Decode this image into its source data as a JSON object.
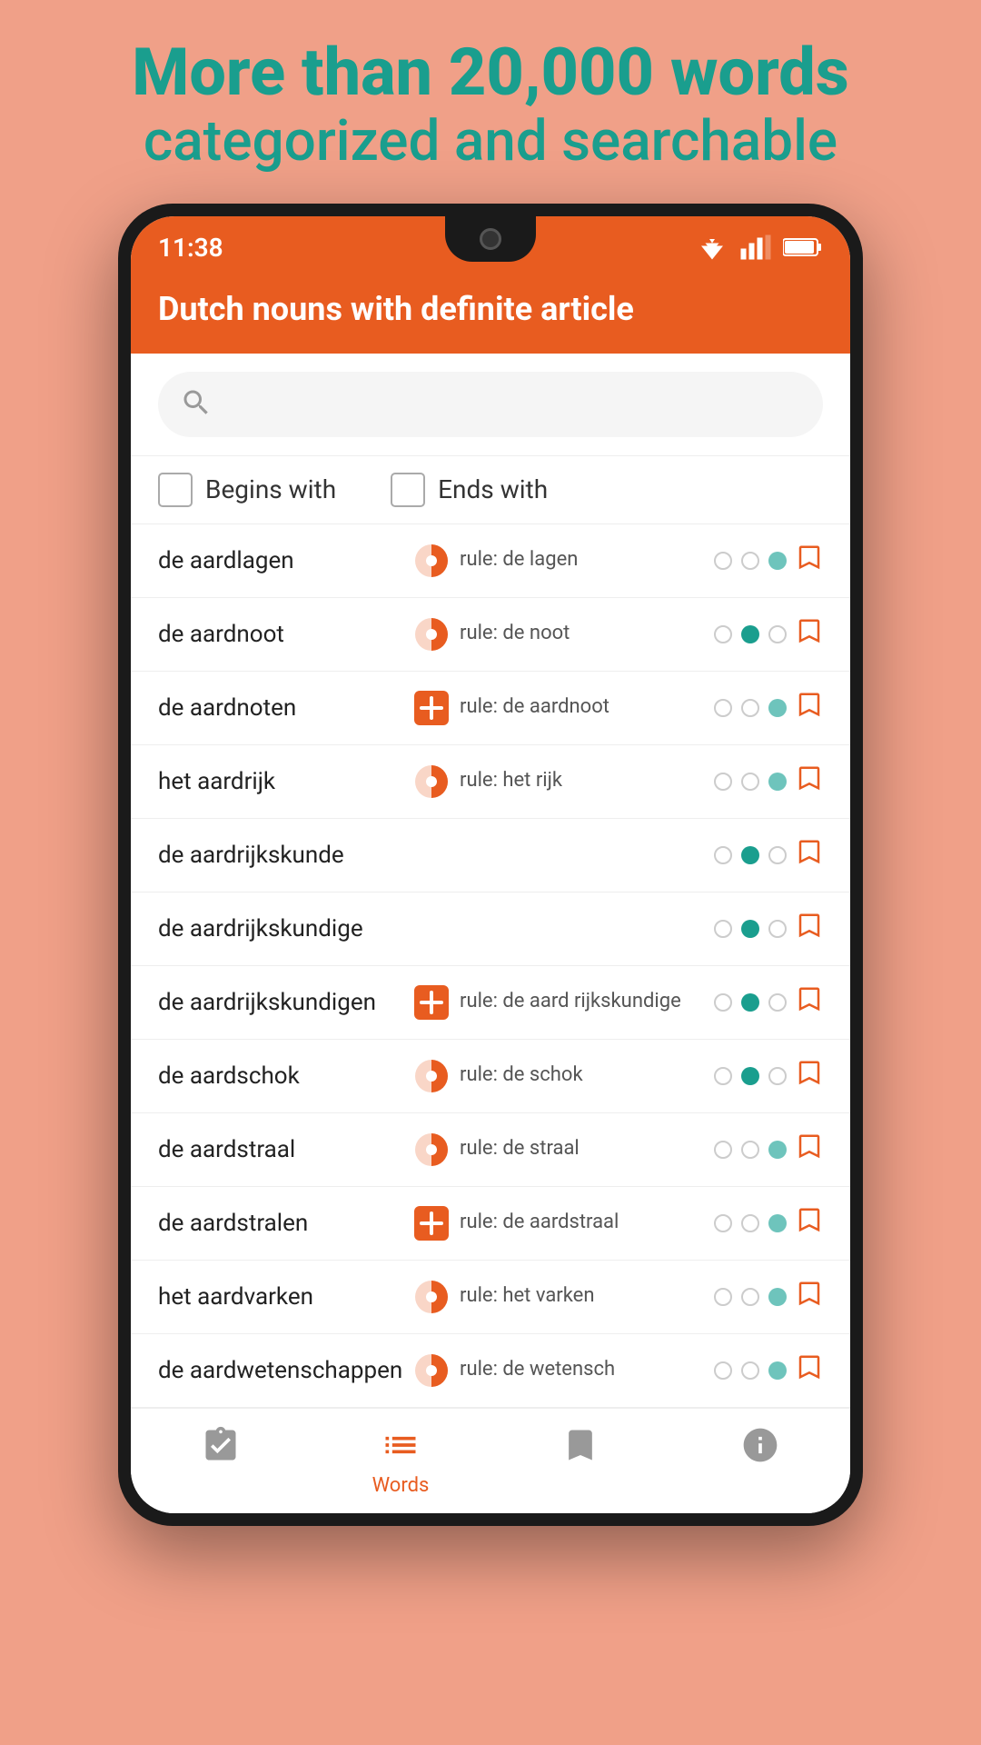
{
  "header": {
    "line1": "More than 20,000 words",
    "line2": "categorized and searchable"
  },
  "status_bar": {
    "time": "11:38"
  },
  "app_bar": {
    "title": "Dutch nouns with definite article"
  },
  "search": {
    "placeholder": ""
  },
  "filters": {
    "begins_with": "Begins with",
    "ends_with": "Ends with"
  },
  "words": [
    {
      "word": "de aardlagen",
      "icon": "half-circle",
      "rule": "rule: de lagen",
      "dots": [
        "empty",
        "empty",
        "teal-light"
      ],
      "bookmarked": false
    },
    {
      "word": "de aardnoot",
      "icon": "half-circle",
      "rule": "rule: de noot",
      "dots": [
        "empty",
        "teal",
        "empty"
      ],
      "bookmarked": false
    },
    {
      "word": "de aardnoten",
      "icon": "plus",
      "rule": "rule: de aardnoot",
      "dots": [
        "empty",
        "empty",
        "teal-light"
      ],
      "bookmarked": false
    },
    {
      "word": "het aardrijk",
      "icon": "half-circle",
      "rule": "rule: het rijk",
      "dots": [
        "empty",
        "empty",
        "teal-light"
      ],
      "bookmarked": false
    },
    {
      "word": "de aardrijkskunde",
      "icon": "none",
      "rule": "",
      "dots": [
        "empty",
        "teal",
        "empty"
      ],
      "bookmarked": false
    },
    {
      "word": "de aardrijkskundige",
      "icon": "none",
      "rule": "",
      "dots": [
        "empty",
        "teal",
        "empty"
      ],
      "bookmarked": false
    },
    {
      "word": "de aardrijkskundigen",
      "icon": "plus",
      "rule": "rule: de aard\nrijkskundige",
      "dots": [
        "empty",
        "teal",
        "empty"
      ],
      "bookmarked": false
    },
    {
      "word": "de aardschok",
      "icon": "half-circle",
      "rule": "rule: de schok",
      "dots": [
        "empty",
        "teal",
        "empty"
      ],
      "bookmarked": false
    },
    {
      "word": "de aardstraal",
      "icon": "half-circle",
      "rule": "rule: de straal",
      "dots": [
        "empty",
        "empty",
        "teal-light"
      ],
      "bookmarked": false
    },
    {
      "word": "de aardstralen",
      "icon": "plus",
      "rule": "rule: de aardstraal",
      "dots": [
        "empty",
        "empty",
        "teal-light"
      ],
      "bookmarked": false
    },
    {
      "word": "het aardvarken",
      "icon": "half-circle",
      "rule": "rule: het varken",
      "dots": [
        "empty",
        "empty",
        "teal-light"
      ],
      "bookmarked": false
    },
    {
      "word": "de aardwetenschappen",
      "icon": "half-circle",
      "rule": "rule: de\nwetensch",
      "dots": [
        "empty",
        "empty",
        "teal-light"
      ],
      "bookmarked": false
    }
  ],
  "bottom_nav": {
    "items": [
      {
        "label": "",
        "icon": "check-clipboard",
        "active": false
      },
      {
        "label": "Words",
        "icon": "list",
        "active": true
      },
      {
        "label": "",
        "icon": "bookmark",
        "active": false
      },
      {
        "label": "",
        "icon": "info",
        "active": false
      }
    ]
  }
}
